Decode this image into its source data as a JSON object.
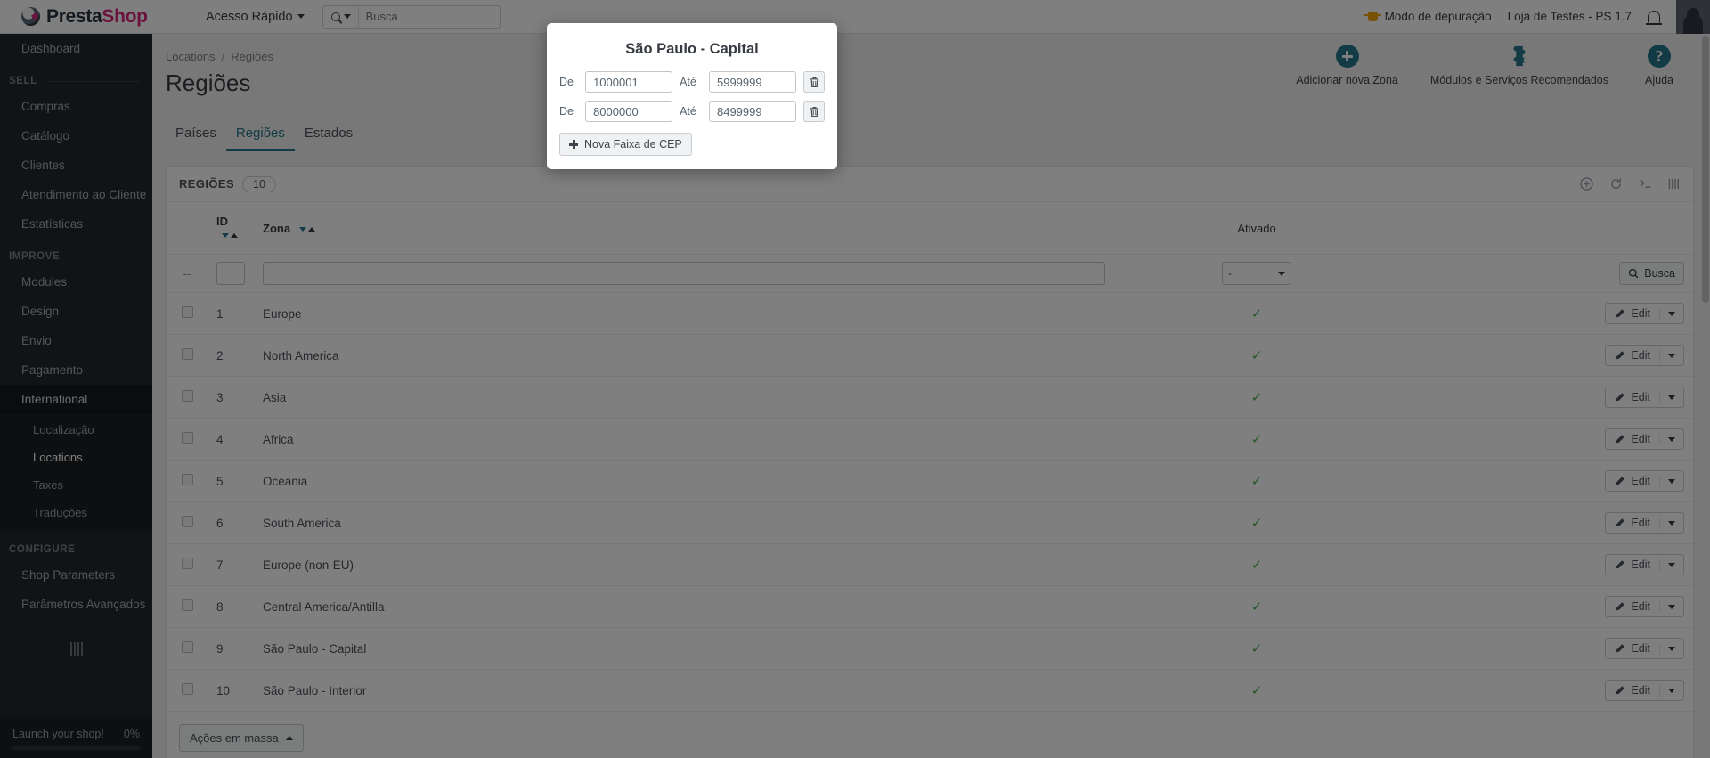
{
  "header": {
    "brand_part1": "Presta",
    "brand_part2": "Shop",
    "quick_access": "Acesso Rápido",
    "search_placeholder": "Busca",
    "search_value": "",
    "debug_mode": "Modo de depuração",
    "shop_name": "Loja de Testes - PS 1.7"
  },
  "sidebar": {
    "dashboard": "Dashboard",
    "sections": [
      {
        "title": "SELL",
        "items": [
          "Compras",
          "Catálogo",
          "Clientes",
          "Atendimento ao Cliente",
          "Estatísticas"
        ]
      },
      {
        "title": "IMPROVE",
        "items": [
          "Modules",
          "Design",
          "Envio",
          "Pagamento",
          "International"
        ]
      },
      {
        "title": "CONFIGURE",
        "items": [
          "Shop Parameters",
          "Parâmetros Avançados"
        ]
      }
    ],
    "international_submenu": [
      "Localização",
      "Locations",
      "Taxes",
      "Traduções"
    ],
    "active_parent": "International",
    "active_sub": "Locations",
    "launch": {
      "label": "Launch your shop!",
      "percent": "0%"
    }
  },
  "breadcrumb": {
    "parent": "Locations",
    "separator": "/",
    "current": "Regiões"
  },
  "page_title": "Regiões",
  "toolbar": [
    {
      "label": "Adicionar nova Zona",
      "icon": "plus-circle-icon"
    },
    {
      "label": "Módulos e Serviços Recomendados",
      "icon": "puzzle-icon"
    },
    {
      "label": "Ajuda",
      "icon": "help-icon"
    }
  ],
  "tabs": [
    {
      "label": "Países",
      "active": false
    },
    {
      "label": "Regiões",
      "active": true
    },
    {
      "label": "Estados",
      "active": false
    }
  ],
  "panel": {
    "title": "REGIÕES",
    "count": "10",
    "columns": {
      "id": "ID",
      "zone": "Zona",
      "enabled": "Ativado"
    },
    "filter": {
      "id_value": "",
      "zone_value": "",
      "enabled_value": "-",
      "search_button": "Busca"
    },
    "rows": [
      {
        "id": "1",
        "zone": "Europe",
        "enabled": true,
        "edit": "Edit"
      },
      {
        "id": "2",
        "zone": "North America",
        "enabled": true,
        "edit": "Edit"
      },
      {
        "id": "3",
        "zone": "Asia",
        "enabled": true,
        "edit": "Edit"
      },
      {
        "id": "4",
        "zone": "Africa",
        "enabled": true,
        "edit": "Edit"
      },
      {
        "id": "5",
        "zone": "Oceania",
        "enabled": true,
        "edit": "Edit"
      },
      {
        "id": "6",
        "zone": "South America",
        "enabled": true,
        "edit": "Edit"
      },
      {
        "id": "7",
        "zone": "Europe (non-EU)",
        "enabled": true,
        "edit": "Edit"
      },
      {
        "id": "8",
        "zone": "Central America/Antilla",
        "enabled": true,
        "edit": "Edit"
      },
      {
        "id": "9",
        "zone": "São Paulo - Capital",
        "enabled": true,
        "edit": "Edit"
      },
      {
        "id": "10",
        "zone": "São Paulo - Interior",
        "enabled": true,
        "edit": "Edit"
      }
    ],
    "bulk_actions": "Ações em massa"
  },
  "modal": {
    "title": "São Paulo - Capital",
    "label_from": "De",
    "label_to": "Até",
    "ranges": [
      {
        "from": "1000001",
        "to": "5999999"
      },
      {
        "from": "8000000",
        "to": "8499999"
      }
    ],
    "new_range_button": "Nova Faixa de CEP"
  },
  "colors": {
    "accent": "#25768b",
    "brand_pink": "#d3277a",
    "sidebar_bg": "#23282d",
    "success_green": "#4caf50",
    "debug_orange": "#f0a30a"
  }
}
